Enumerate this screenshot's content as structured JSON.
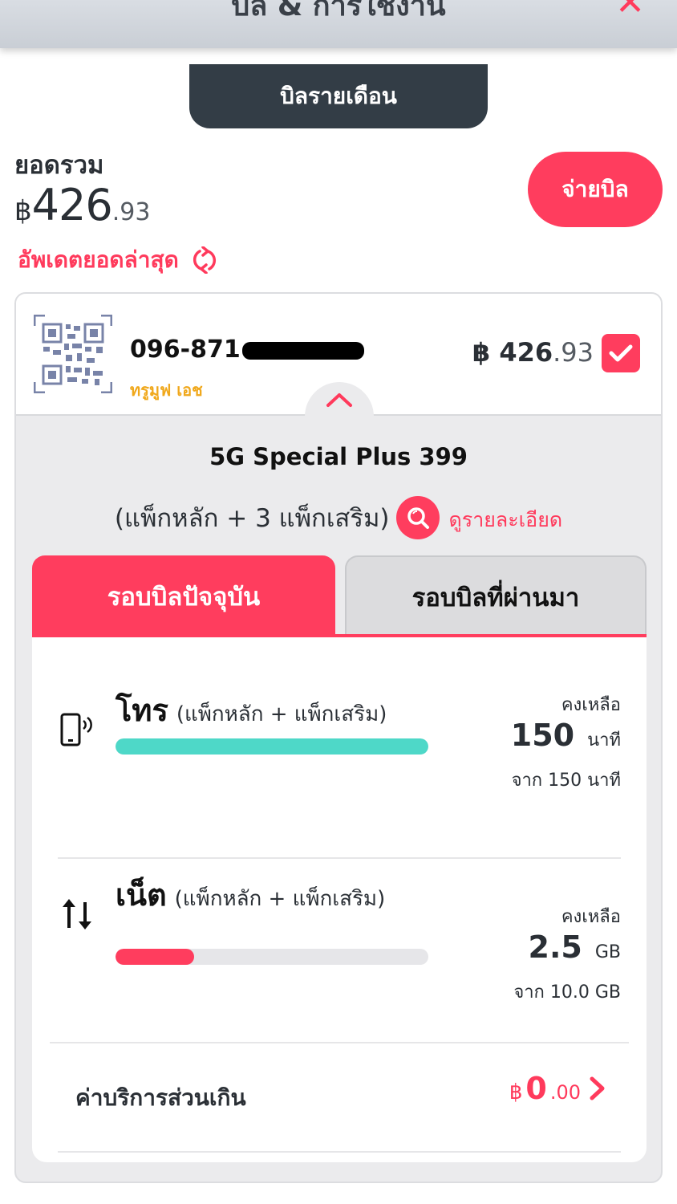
{
  "header": {
    "title": "บิล & การใช้งาน",
    "close_label": "✕"
  },
  "bill_tab": {
    "label": "บิลรายเดือน"
  },
  "summary": {
    "total_label": "ยอดรวม",
    "currency": "฿",
    "amount_int": "426",
    "amount_dec": ".93",
    "update_label": "อัพเดตยอดล่าสุด",
    "pay_button": "จ่ายบิล"
  },
  "account": {
    "phone": "096-871",
    "brand": "ทรูมูฟ เอช",
    "currency": "฿",
    "amount_int": "426",
    "amount_dec": ".93",
    "selected": true
  },
  "package": {
    "name": "5G Special Plus 399",
    "sub": "(แพ็กหลัก + 3 แพ็กเสริม)",
    "detail_link": "ดูรายละเอียด"
  },
  "cycle_tabs": {
    "current": "รอบบิลปัจจุบัน",
    "previous": "รอบบิลที่ผ่านมา"
  },
  "usage": {
    "call": {
      "title": "โทร",
      "sub": "(แพ็กหลัก + แพ็กเสริม)",
      "remain_label": "คงเหลือ",
      "remain": "150",
      "unit": "นาที",
      "of": "จาก 150 นาที",
      "fraction": 1.0,
      "color": "#4ed8c8"
    },
    "data": {
      "title": "เน็ต",
      "sub": "(แพ็กหลัก + แพ็กเสริม)",
      "remain_label": "คงเหลือ",
      "remain": "2.5",
      "unit": "GB",
      "of": "จาก 10.0 GB",
      "fraction": 0.25,
      "color": "#ff3d5e"
    }
  },
  "extra_charge": {
    "label": "ค่าบริการส่วนเกิน",
    "currency": "฿",
    "amount_int": "0",
    "amount_dec": ".00"
  },
  "colors": {
    "accent": "#ff3d5e",
    "dark": "#333d46",
    "teal": "#4ed8c8"
  }
}
